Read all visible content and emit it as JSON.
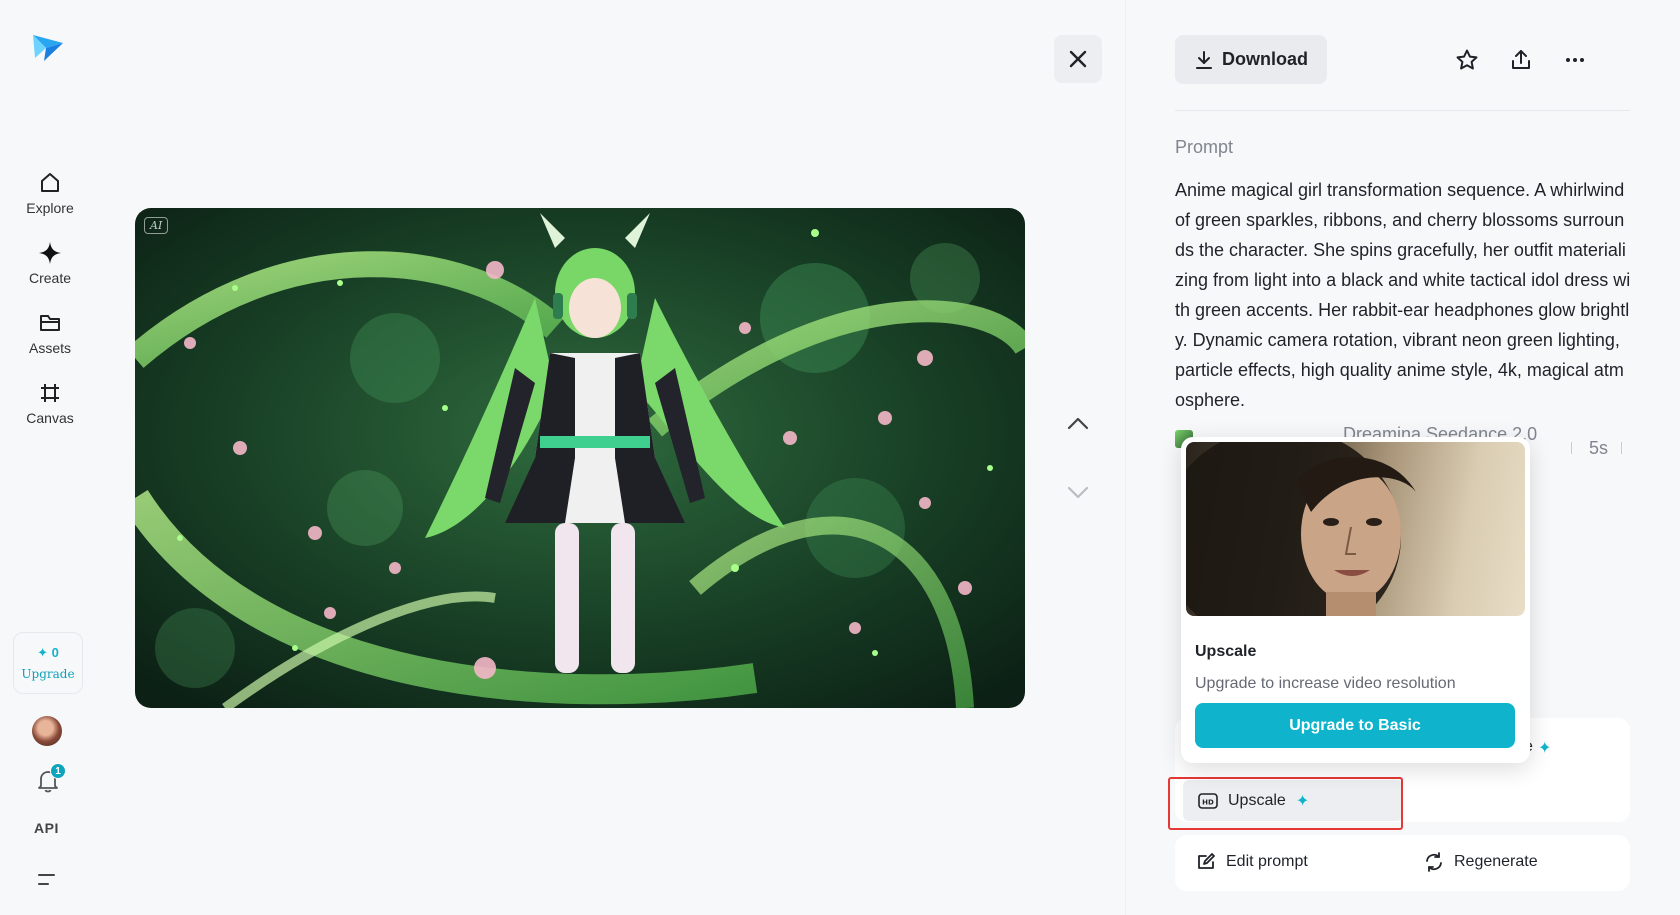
{
  "sidebar": {
    "items": [
      {
        "label": "Explore",
        "icon": "home-icon"
      },
      {
        "label": "Create",
        "icon": "sparkle-icon"
      },
      {
        "label": "Assets",
        "icon": "folder-icon"
      },
      {
        "label": "Canvas",
        "icon": "crop-icon"
      }
    ],
    "credits": "0",
    "upgrade_label": "Upgrade",
    "notifications_count": "1",
    "api_label": "API"
  },
  "viewer": {
    "ai_tag": "AI"
  },
  "panel": {
    "download_label": "Download",
    "prompt_label": "Prompt",
    "prompt_text": "Anime magical girl transformation sequence. A whirlwind of green sparkles, ribbons, and cherry blossoms surrounds the character. She spins gracefully, her outfit materializing from light into a black and white tactical idol dress with green accents. Her rabbit-ear headphones glow brightly. Dynamic camera rotation, vibrant neon green lighting, particle effects, high quality anime style, 4k, magical atmosphere.",
    "model": "Dreamina Seedance 2.0",
    "duration": "5s",
    "upscale_label": "Upscale",
    "edit_prompt_label": "Edit prompt",
    "regenerate_label": "Regenerate"
  },
  "popover": {
    "title": "Upscale",
    "description": "Upgrade to increase video resolution",
    "cta": "Upgrade to Basic"
  },
  "colors": {
    "accent": "#0fb4cc",
    "highlight": "#e53935"
  }
}
